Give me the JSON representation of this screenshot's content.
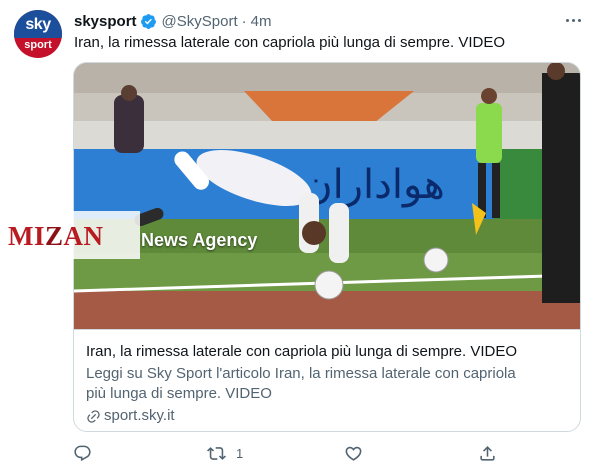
{
  "tweet": {
    "author_name": "skysport",
    "author_handle": "@SkySport",
    "separator": "·",
    "time": "4m",
    "text": "Iran, la rimessa laterale con capriola più lunga di sempre. VIDEO",
    "avatar": {
      "line1": "sky",
      "line2": "sport",
      "colors": {
        "top": "#1b4f9c",
        "bottom": "#c4102b"
      }
    },
    "verified_color": "#1d9bf0"
  },
  "card": {
    "title": "Iran, la rimessa laterale con capriola più lunga di sempre. VIDEO",
    "description": "Leggi su Sky Sport l'articolo Iran, la rimessa laterale con capriola più lunga di sempre. VIDEO",
    "domain": "sport.sky.it",
    "image": {
      "banner_text": "هواداران",
      "description_icons": [
        "player-flipping-icon",
        "football-icon",
        "referee-icon"
      ]
    }
  },
  "watermark": {
    "logo_pre": "MI",
    "logo_z": "Z",
    "logo_post": "AN",
    "label": "News Agency",
    "color": "#b81b21"
  },
  "actions": {
    "reply_count": "",
    "retweet_count": "1",
    "like_count": "",
    "share_count": ""
  },
  "colors": {
    "text": "#0f1419",
    "secondary": "#536471",
    "border": "#cfd9de"
  }
}
